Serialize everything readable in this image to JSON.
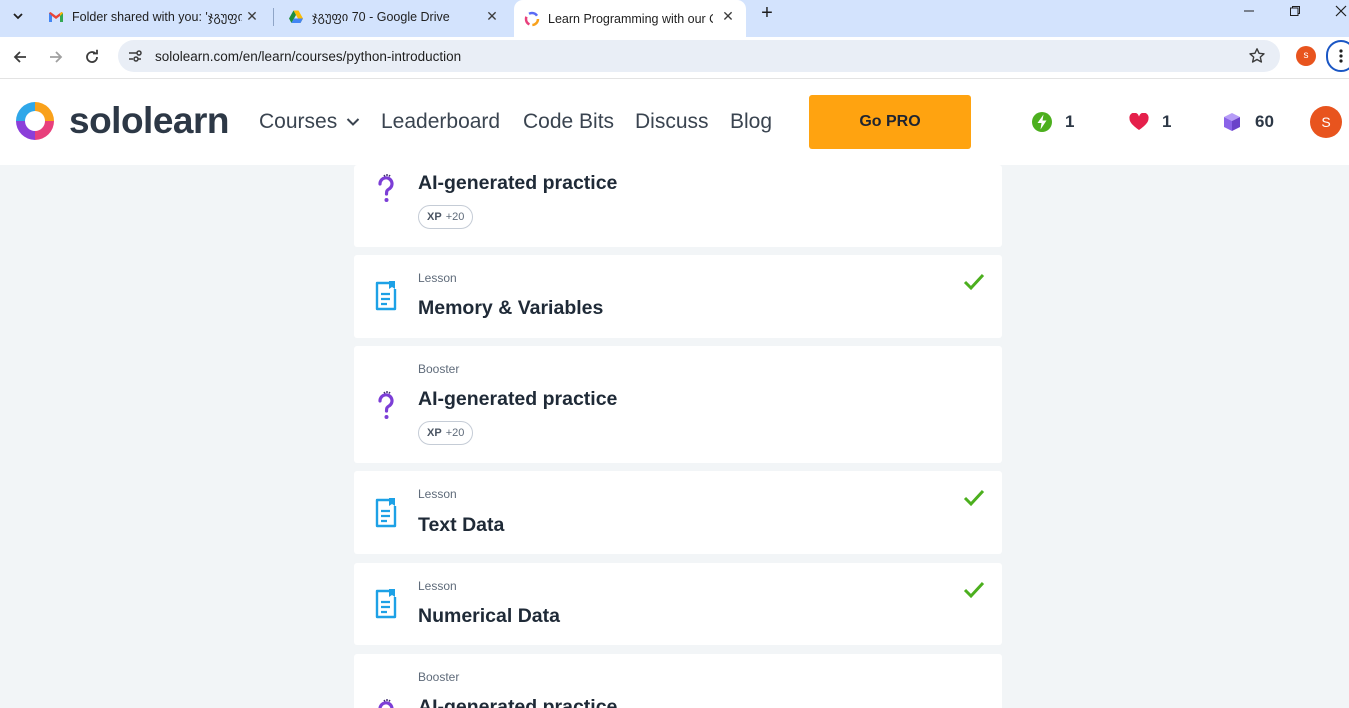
{
  "browser": {
    "tabs": [
      {
        "title": "Folder shared with you: 'ჯგუფი",
        "favicon": "gmail-icon"
      },
      {
        "title": "ჯგუფი 70 - Google Drive",
        "favicon": "google-drive-icon"
      },
      {
        "title": "Learn Programming with our Online",
        "favicon": "sololearn-icon"
      }
    ],
    "url": "sololearn.com/en/learn/courses/python-introduction",
    "profile_initial": "s"
  },
  "header": {
    "logo_text": "sololearn",
    "nav": [
      "Courses",
      "Leaderboard",
      "Code Bits",
      "Discuss",
      "Blog"
    ],
    "cta": "Go PRO",
    "stats": {
      "streak": "1",
      "hearts": "1",
      "gems": "60"
    },
    "avatar_initial": "S"
  },
  "colors": {
    "accent": "#ffa310",
    "check": "#4caf1e",
    "lesson_icon": "#1da1e6",
    "booster_icon": "#7c3ed6"
  },
  "cards": [
    {
      "type": "booster",
      "kind": "",
      "title": "AI-generated practice",
      "xp_label": "XP",
      "xp": "+20",
      "completed": false
    },
    {
      "type": "lesson",
      "kind": "Lesson",
      "title": "Memory & Variables",
      "completed": true
    },
    {
      "type": "booster",
      "kind": "Booster",
      "title": "AI-generated practice",
      "xp_label": "XP",
      "xp": "+20",
      "completed": false
    },
    {
      "type": "lesson",
      "kind": "Lesson",
      "title": "Text Data",
      "completed": true
    },
    {
      "type": "lesson",
      "kind": "Lesson",
      "title": "Numerical Data",
      "completed": true
    },
    {
      "type": "booster",
      "kind": "Booster",
      "title": "AI-generated practice",
      "completed": false
    }
  ]
}
